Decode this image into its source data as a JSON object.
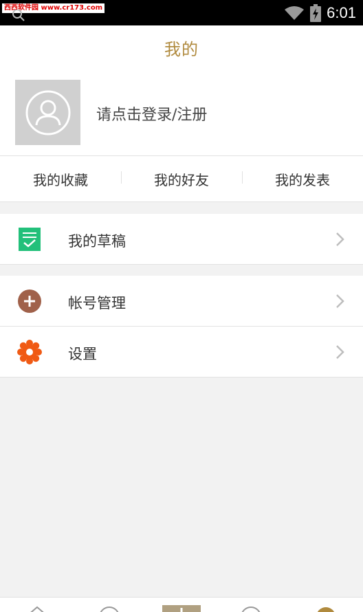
{
  "status_bar": {
    "watermark": "西西软件园 www.cr173.com",
    "time": "6:01"
  },
  "header": {
    "title": "我的"
  },
  "profile": {
    "login_prompt": "请点击登录/注册"
  },
  "tabs": [
    {
      "label": "我的收藏"
    },
    {
      "label": "我的好友"
    },
    {
      "label": "我的发表"
    }
  ],
  "menu": {
    "drafts": {
      "label": "我的草稿",
      "icon": "draft-icon",
      "color": "#22c07a"
    },
    "account": {
      "label": "帐号管理",
      "icon": "plus-circle-icon",
      "color": "#a0614a"
    },
    "settings": {
      "label": "设置",
      "icon": "gear-icon",
      "color": "#f05a14"
    }
  },
  "colors": {
    "accent": "#b08a3e",
    "background": "#f2f2f2"
  }
}
